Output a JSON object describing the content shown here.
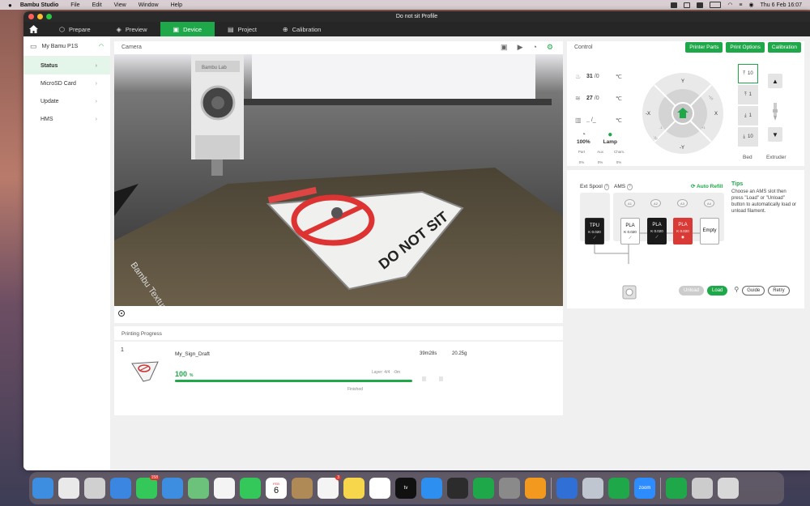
{
  "menubar": {
    "apple": "",
    "items": [
      "Bambu Studio",
      "File",
      "Edit",
      "View",
      "Window",
      "Help"
    ],
    "clock": "Thu 6 Feb 16:07"
  },
  "window": {
    "title": "Do not sit Profile"
  },
  "tabs": [
    {
      "label": "Prepare",
      "icon": "cube-icon"
    },
    {
      "label": "Preview",
      "icon": "layers-icon"
    },
    {
      "label": "Device",
      "icon": "device-icon"
    },
    {
      "label": "Project",
      "icon": "project-icon"
    },
    {
      "label": "Calibration",
      "icon": "calibration-icon"
    }
  ],
  "sidebar": {
    "printer_name": "My Bamu P1S",
    "items": [
      {
        "label": "Status"
      },
      {
        "label": "MicroSD Card"
      },
      {
        "label": "Update"
      },
      {
        "label": "HMS"
      }
    ]
  },
  "camera": {
    "title": "Camera",
    "bed_text": "DO NOT SIT",
    "plate_text": "Bambu Textured PEI Plate",
    "toolhead_text": "Bambu Lab"
  },
  "progress": {
    "title": "Printing Progress",
    "index": "1",
    "file_name": "My_Sign_Draft",
    "time": "39m28s",
    "weight": "20.25g",
    "percent": "100",
    "percent_unit": "%",
    "layer": "Layer: 4/4",
    "remaining": "-0m",
    "status": "Finished",
    "progress_fraction": 1.0
  },
  "control": {
    "title": "Control",
    "buttons": [
      "Printer Parts",
      "Print Options",
      "Calibration"
    ],
    "temps": [
      {
        "value": "31",
        "target": "/0",
        "unit": "℃",
        "icon": "nozzle-icon"
      },
      {
        "value": "27",
        "target": "/0",
        "unit": "℃",
        "icon": "bed-heat-icon"
      },
      {
        "value": "_",
        "target": "/_",
        "unit": "℃",
        "icon": "chamber-icon"
      }
    ],
    "speed": "100%",
    "lamp": "Lamp",
    "fans": [
      {
        "label": "Part",
        "value": "0%"
      },
      {
        "label": "Aux",
        "value": "0%"
      },
      {
        "label": "Cham.",
        "value": "0%"
      }
    ],
    "jog": {
      "y": "Y",
      "neg_y": "-Y",
      "x": "X",
      "neg_x": "-X",
      "plus10": "+10",
      "plus1": "+1",
      "minus1": "-1",
      "minus10": "-10"
    },
    "bed_steps": [
      "10",
      "1",
      "1",
      "10"
    ],
    "bed_label": "Bed",
    "extruder_label": "Extruder",
    "ams": {
      "ext_spool": "Ext Spool",
      "ams_label": "AMS",
      "auto_refill": "Auto Refill",
      "tips_title": "Tips",
      "tips_text": "Choose an AMS slot then press \"Load\" or \"Unload\" button to automatically load or unload filament.",
      "slots": [
        {
          "id": "A1",
          "type": "PLA",
          "k": "K 0.020",
          "color": "#ffffff",
          "text": "#111"
        },
        {
          "id": "A2",
          "type": "PLA",
          "k": "K 0.020",
          "color": "#1a1a1a",
          "text": "#fff"
        },
        {
          "id": "A3",
          "type": "PLA",
          "k": "K 0.020",
          "color": "#d93a35",
          "text": "#fff"
        },
        {
          "id": "A4",
          "type": "Empty",
          "k": "",
          "color": "#ffffff",
          "text": "#111"
        }
      ],
      "ext": {
        "type": "TPU",
        "k": "K 0.020",
        "color": "#1a1a1a",
        "text": "#fff"
      },
      "unload": "Unload",
      "load": "Load",
      "guide": "Guide",
      "retry": "Retry"
    }
  },
  "dock": {
    "apps": [
      {
        "name": "Finder",
        "color": "#3d8de0"
      },
      {
        "name": "Chrome",
        "color": "#e9e9e9"
      },
      {
        "name": "Launchpad",
        "color": "#d0d0d0"
      },
      {
        "name": "Safari",
        "color": "#3a86e0"
      },
      {
        "name": "Messages",
        "color": "#34c759",
        "badge": "158"
      },
      {
        "name": "Mail",
        "color": "#3d8de0"
      },
      {
        "name": "Maps",
        "color": "#6cc17b"
      },
      {
        "name": "Photos",
        "color": "#f4f4f4"
      },
      {
        "name": "FaceTime",
        "color": "#34c759"
      },
      {
        "name": "Calendar",
        "color": "#ffffff",
        "month": "FEB",
        "day": "6"
      },
      {
        "name": "Notes Brown",
        "color": "#b08a56"
      },
      {
        "name": "Reminders",
        "color": "#f4f4f4",
        "badge": "3"
      },
      {
        "name": "Notes",
        "color": "#f7d64b"
      },
      {
        "name": "Freeform",
        "color": "#ffffff"
      },
      {
        "name": "TV",
        "color": "#111111",
        "label": "tv"
      },
      {
        "name": "App Store",
        "color": "#2d8ff0"
      },
      {
        "name": "Bambu",
        "color": "#2c2c2c"
      },
      {
        "name": "Numbers",
        "color": "#1fa84a"
      },
      {
        "name": "System Settings",
        "color": "#8a8a8a"
      },
      {
        "name": "VLC",
        "color": "#f39a1e"
      },
      {
        "name": "VirtualBuddy",
        "color": "#2f6fd6"
      },
      {
        "name": "Preview",
        "color": "#c0c6d0"
      },
      {
        "name": "Numbers 2",
        "color": "#1fa84a"
      },
      {
        "name": "Zoom",
        "color": "#2d8cff",
        "label": "zoom"
      },
      {
        "name": "Numbers 3",
        "color": "#1fa84a"
      },
      {
        "name": "Keyboard",
        "color": "#cccccc"
      },
      {
        "name": "Trash",
        "color": "#d8d8d8"
      }
    ]
  }
}
